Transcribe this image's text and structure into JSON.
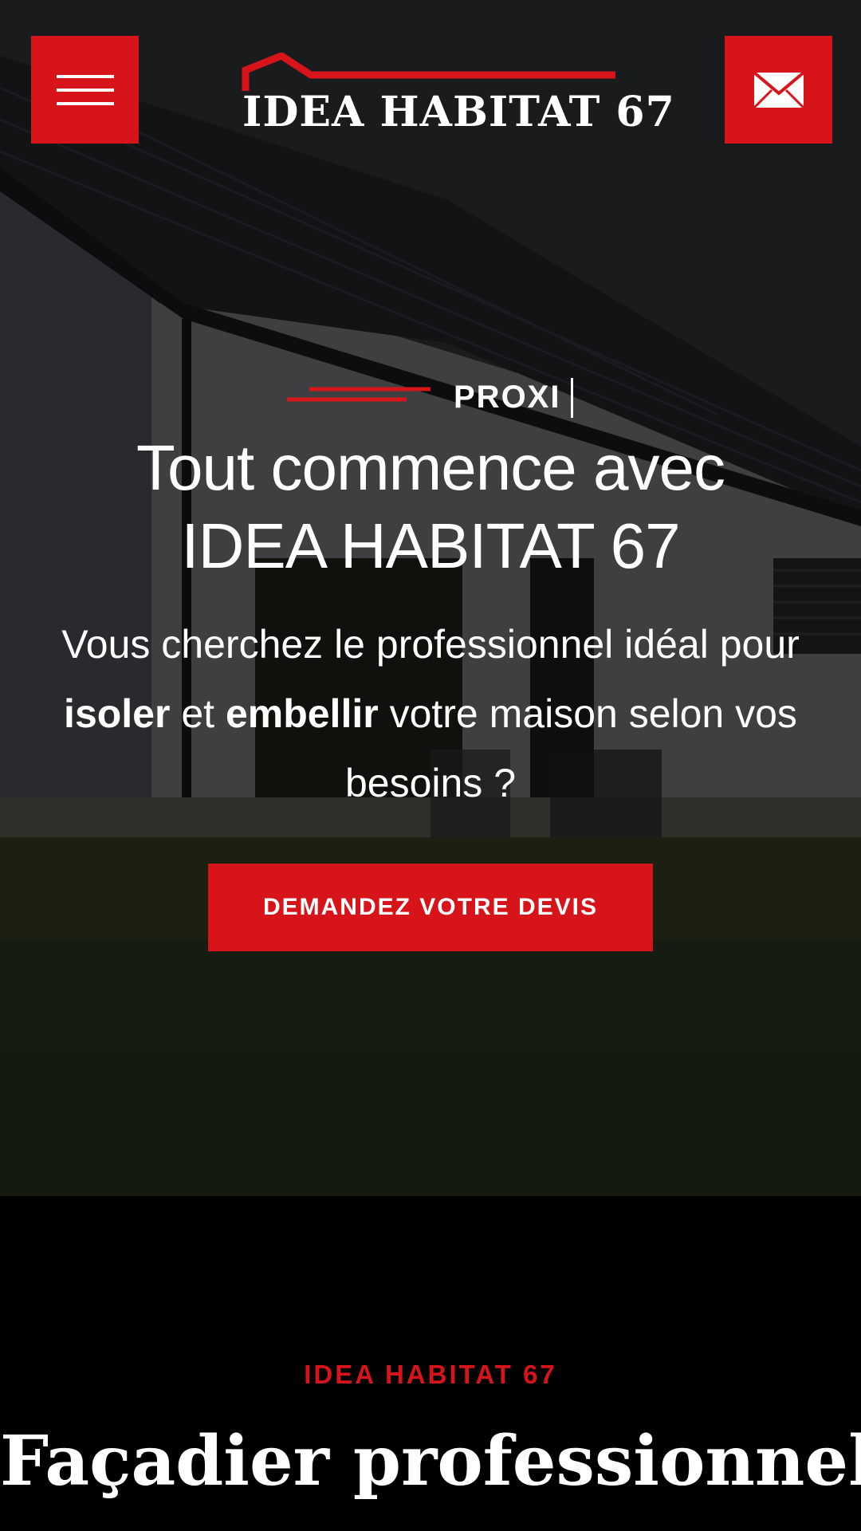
{
  "header": {
    "menu_icon": "hamburger-menu-icon",
    "mail_icon": "envelope-icon",
    "logo_text": "IDEA HABITAT 67"
  },
  "hero": {
    "eyebrow": "PROXI",
    "title_line1": "Tout commence avec",
    "title_line2": "IDEA HABITAT 67",
    "subtitle": {
      "part1": "Vous cherchez le professionnel idéal pour ",
      "bold1": "isoler",
      "part2": " et ",
      "bold2": "embellir",
      "part3": " votre maison selon vos besoins ?"
    },
    "cta_label": "DEMANDEZ VOTRE DEVIS"
  },
  "section2": {
    "label": "IDEA HABITAT 67",
    "title": "Façadier professionnel"
  },
  "colors": {
    "accent": "#d7141a",
    "background": "#000000",
    "text": "#ffffff"
  }
}
